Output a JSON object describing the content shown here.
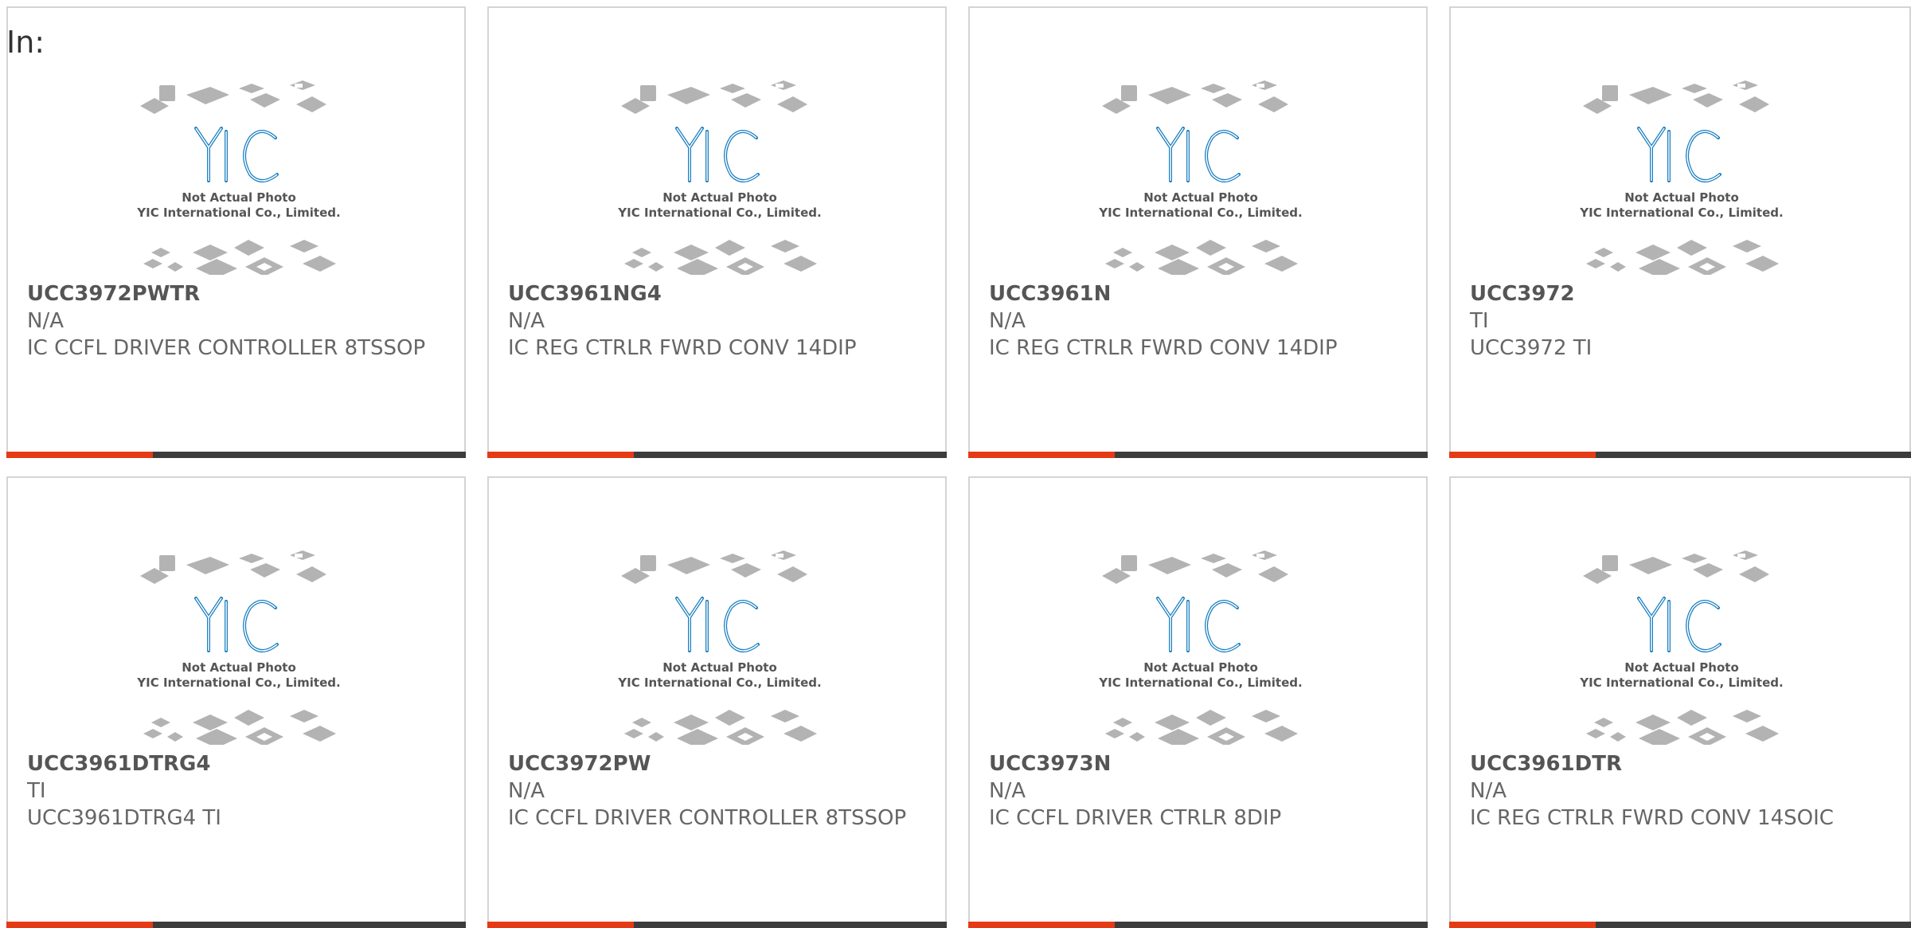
{
  "heading": "In:",
  "watermark": {
    "line1": "Not Actual Photo",
    "line2": "YIC International Co., Limited.",
    "logo_text": "YIC"
  },
  "colors": {
    "accent": "#e53a16",
    "bar": "#3c3c3c",
    "logo_blue": "#1a7fc1",
    "chip_grey": "#b3b3b3"
  },
  "products": [
    {
      "part": "UCC3972PWTR",
      "maker": "N/A",
      "desc": "IC CCFL DRIVER CONTROLLER 8TSSOP"
    },
    {
      "part": "UCC3961NG4",
      "maker": "N/A",
      "desc": "IC REG CTRLR FWRD CONV 14DIP"
    },
    {
      "part": "UCC3961N",
      "maker": "N/A",
      "desc": "IC REG CTRLR FWRD CONV 14DIP"
    },
    {
      "part": "UCC3972",
      "maker": "TI",
      "desc": "UCC3972 TI"
    },
    {
      "part": "UCC3961DTRG4",
      "maker": "TI",
      "desc": "UCC3961DTRG4 TI"
    },
    {
      "part": "UCC3972PW",
      "maker": "N/A",
      "desc": "IC CCFL DRIVER CONTROLLER 8TSSOP"
    },
    {
      "part": "UCC3973N",
      "maker": "N/A",
      "desc": "IC CCFL DRIVER CTRLR 8DIP"
    },
    {
      "part": "UCC3961DTR",
      "maker": "N/A",
      "desc": "IC REG CTRLR FWRD CONV 14SOIC"
    }
  ]
}
